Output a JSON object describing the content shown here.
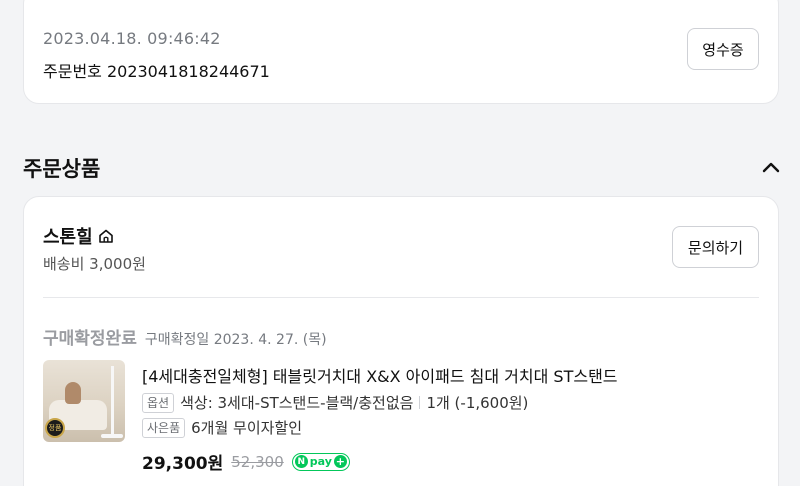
{
  "order": {
    "timestamp": "2023.04.18. 09:46:42",
    "order_number": "주문번호 2023041818244671",
    "receipt_label": "영수증"
  },
  "section": {
    "title": "주문상품",
    "collapse_icon": "chevron-up-icon"
  },
  "seller": {
    "name": "스톤힐",
    "home_icon": "home-icon",
    "shipping": "배송비 3,000원",
    "inquiry_label": "문의하기"
  },
  "item": {
    "status": "구매확정완료",
    "status_date": "구매확정일 2023. 4. 27. (목)",
    "title": "[4세대충전일체형] 태블릿거치대 X&X 아이패드 침대 거치대 ST스탠드",
    "option_tag": "옵션",
    "option_text": "색상: 3세대-ST스탠드-블랙/충전없음",
    "quantity": "1개 (-1,600원)",
    "gift_tag": "사은품",
    "gift_text": "6개월 무이자할인",
    "price": "29,300원",
    "original_price": "52,300",
    "npay": {
      "n": "N",
      "text": "pay",
      "plus": "+",
      "color": "#03c75a"
    },
    "thumb_badge": "정품"
  }
}
